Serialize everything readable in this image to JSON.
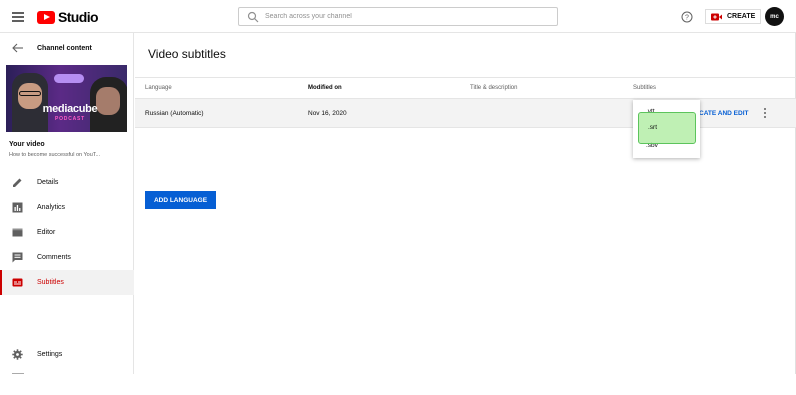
{
  "header": {
    "logo_text": "Studio",
    "search_placeholder": "Search across your channel",
    "create_label": "CREATE",
    "avatar_text": "mc"
  },
  "sidebar": {
    "back_label": "Channel content",
    "thumbnail": {
      "brand": "mediacube",
      "brand_sub": "PODCAST"
    },
    "your_video_label": "Your video",
    "video_title": "How to become successful on YouT...",
    "items": [
      {
        "label": "Details",
        "icon": "pencil-icon",
        "active": false
      },
      {
        "label": "Analytics",
        "icon": "analytics-icon",
        "active": false
      },
      {
        "label": "Editor",
        "icon": "editor-icon",
        "active": false
      },
      {
        "label": "Comments",
        "icon": "comments-icon",
        "active": false
      },
      {
        "label": "Subtitles",
        "icon": "subtitles-icon",
        "active": true
      }
    ],
    "settings_label": "Settings"
  },
  "main": {
    "page_title": "Video subtitles",
    "columns": [
      "Language",
      "Modified on",
      "Title & description",
      "Subtitles"
    ],
    "rows": [
      {
        "language": "Russian (Automatic)",
        "modified": "Nov 16, 2020",
        "action": "CATE AND EDIT"
      }
    ],
    "add_language": "ADD LANGUAGE"
  },
  "dropdown": {
    "options": [
      ".vtt",
      ".srt",
      ".sbv"
    ],
    "highlighted": ".srt"
  },
  "colors": {
    "brand_red": "#ff0000",
    "accent_blue": "#065fd4",
    "active_red": "#cc0000",
    "highlight_green": "#aaeb9b"
  }
}
